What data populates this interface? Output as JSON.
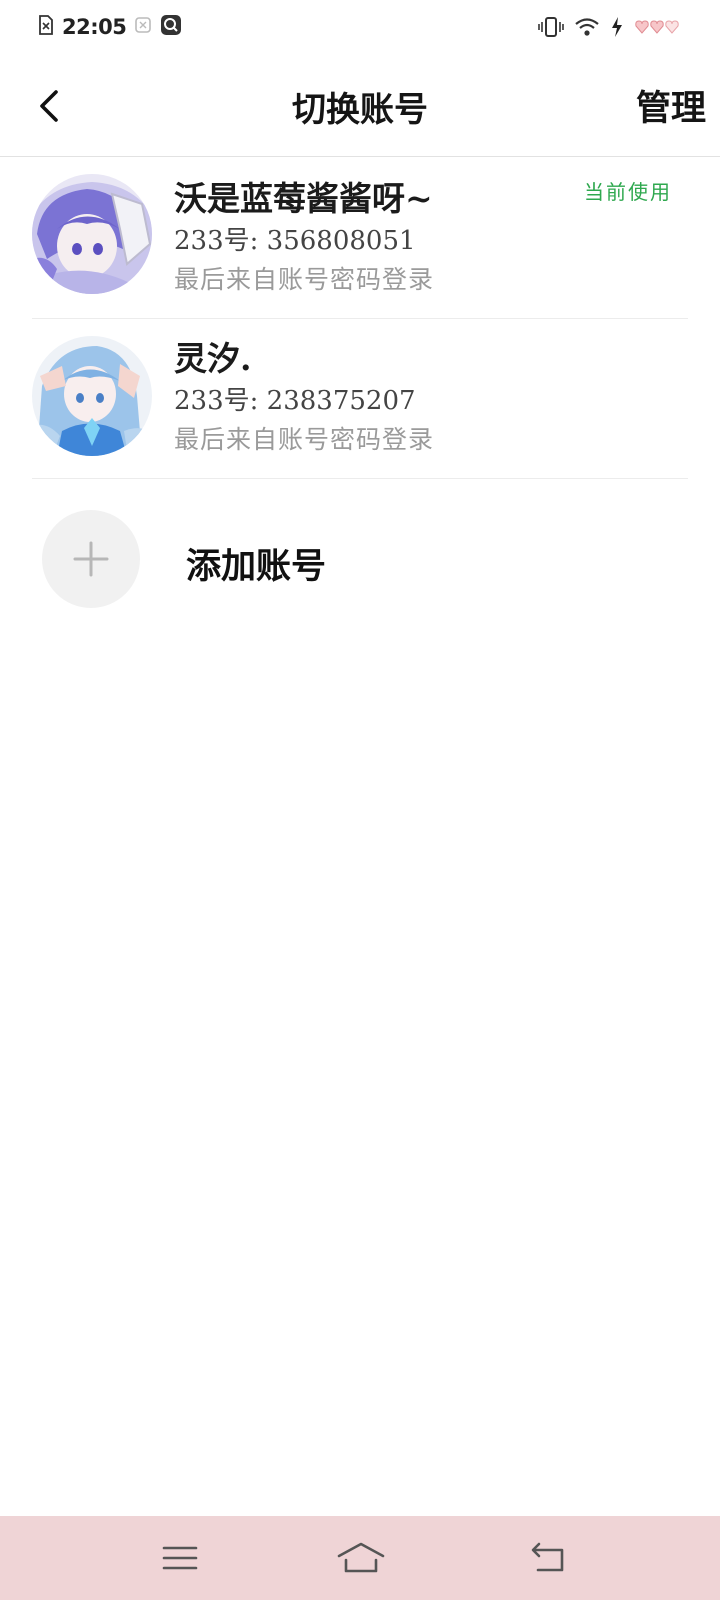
{
  "status_bar": {
    "time": "22:05"
  },
  "header": {
    "title": "切换账号",
    "manage_label": "管理"
  },
  "accounts": [
    {
      "name": "沃是蓝莓酱酱呀~",
      "id_text": "233号: 356808051",
      "login_info": "最后来自账号密码登录",
      "badge": "当前使用"
    },
    {
      "name": "灵汐.",
      "id_text": "233号: 238375207",
      "login_info": "最后来自账号密码登录"
    }
  ],
  "add_account": {
    "label": "添加账号"
  },
  "icons": {
    "back": "chevron-left-icon",
    "add": "plus-icon",
    "nav_menu": "menu-icon",
    "nav_home": "home-icon",
    "nav_back": "back-icon"
  },
  "colors": {
    "current_badge": "#2fa84f",
    "navbar_bg": "#efd4d6",
    "divider": "#ececec"
  }
}
